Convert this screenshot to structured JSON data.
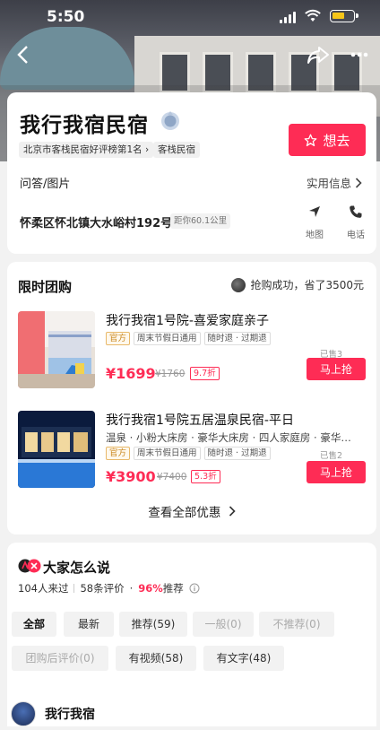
{
  "status_bar": {
    "time": "5:50"
  },
  "header": {
    "title": "我行我宿民宿",
    "rank_tag": "北京市客栈民宿好评榜第1名",
    "type_tag": "客栈民宿",
    "want_label": "想去"
  },
  "info": {
    "qa_label": "问答/图片",
    "info_link": "实用信息",
    "address": "怀柔区怀北镇大水峪村192号",
    "distance": "距你60.1公里",
    "map_label": "地图",
    "phone_label": "电话"
  },
  "deals": {
    "title": "限时团购",
    "grab_text": "抢购成功，省了3500元",
    "items": [
      {
        "name": "我行我宿1号院-喜爱家庭亲子",
        "tags": [
          "官方",
          "周末节假日通用",
          "随时退 · 过期退"
        ],
        "price": "¥1699",
        "original": "¥1760",
        "discount": "9.7折",
        "sold": "已售3",
        "buy_label": "马上抢"
      },
      {
        "name": "我行我宿1号院五居温泉民宿-平日",
        "rooms": "温泉 · 小粉大床房 · 豪华大床房 · 四人家庭房 · 豪华…",
        "tags": [
          "官方",
          "周末节假日通用",
          "随时退 · 过期退"
        ],
        "price": "¥3900",
        "original": "¥7400",
        "discount": "5.3折",
        "sold": "已售2",
        "buy_label": "马上抢"
      }
    ],
    "view_all": "查看全部优惠"
  },
  "reviews": {
    "title": "大家怎么说",
    "visited": "104人来过",
    "count": "58条评价",
    "recommend_pct": "96%",
    "recommend_label": "推荐",
    "chips": [
      "全部",
      "最新",
      "推荐(59)",
      "一般(0)",
      "不推荐(0)",
      "团购后评价(0)",
      "有视频(58)",
      "有文字(48)"
    ]
  },
  "bottom_user": {
    "name": "我行我宿"
  },
  "colors": {
    "accent": "#fe2c55",
    "official": "#c8861c"
  }
}
